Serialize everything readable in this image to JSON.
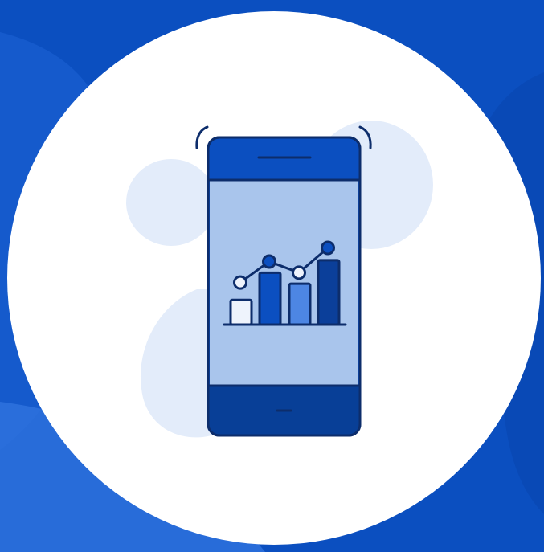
{
  "icon": {
    "name": "smartphone-analytics-icon",
    "description_visible_text": ""
  },
  "colors": {
    "background_dark": "#0b4fc0",
    "background_light": "#2f73de",
    "circle": "#ffffff",
    "blob": "#e3ecfa",
    "outline": "#0d2d6b",
    "phone_top": "#0b4fc0",
    "phone_screen": "#a9c5ec",
    "phone_bottom": "#083f97",
    "bar_light": "#eef3fc",
    "bar_dark": "#0b4fc0",
    "bar_mid": "#4d86e3",
    "bar_darkest": "#0b3f9a"
  },
  "chart_data": {
    "type": "bar",
    "categories": [
      "",
      "",
      "",
      ""
    ],
    "values": [
      2,
      4.2,
      3.3,
      5.2
    ],
    "line_values": [
      3.4,
      5.1,
      4.2,
      6.2
    ],
    "title": "",
    "xlabel": "",
    "ylabel": ""
  }
}
